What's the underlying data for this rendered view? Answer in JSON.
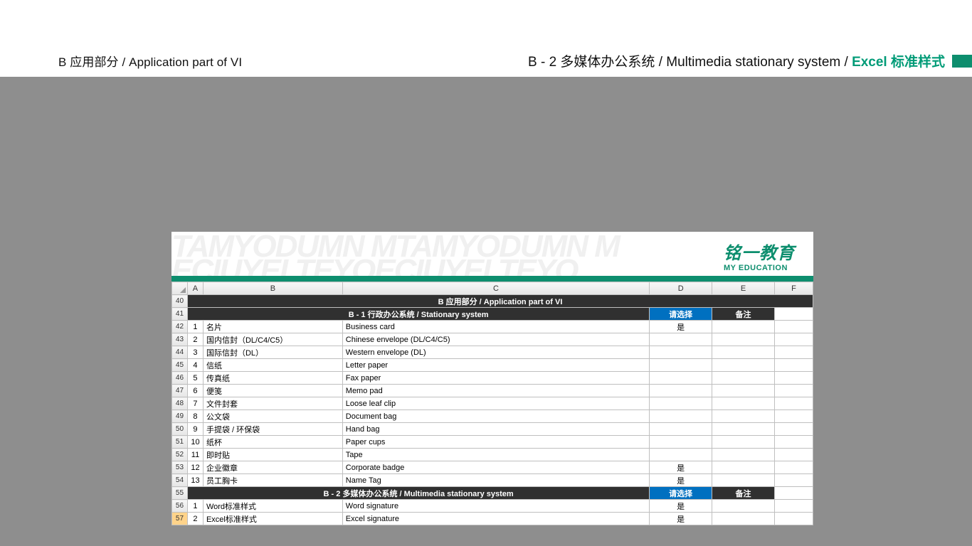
{
  "header": {
    "left": "B 应用部分 / Application part of VI",
    "right_prefix": "B - 2 多媒体办公系统 / Multimedia stationary system / ",
    "right_accent": "Excel 标准样式"
  },
  "brand": {
    "watermark_line1": "TAMYODUMN MTAMYODUMN M",
    "watermark_line2": "ECIUYELTEYOECIUYELTEYO",
    "logo_zh": "铭一教育",
    "logo_en": "MY EDUCATION"
  },
  "columns": [
    "",
    "A",
    "B",
    "C",
    "D",
    "E",
    "F"
  ],
  "row_start": 40,
  "selected_row": 57,
  "title_row": "B 应用部分 / Application part of VI",
  "section1": {
    "heading": "B - 1 行政办公系统 / Stationary system",
    "status_label": "请选择",
    "note_label": "备注",
    "rows": [
      {
        "n": "1",
        "zh": "名片",
        "en": "Business card",
        "d": "是"
      },
      {
        "n": "2",
        "zh": "国内信封（DL/C4/C5）",
        "en": "Chinese envelope (DL/C4/C5)",
        "d": ""
      },
      {
        "n": "3",
        "zh": "国际信封（DL）",
        "en": "Western envelope (DL)",
        "d": ""
      },
      {
        "n": "4",
        "zh": "信纸",
        "en": "Letter paper",
        "d": ""
      },
      {
        "n": "5",
        "zh": "传真纸",
        "en": "Fax paper",
        "d": ""
      },
      {
        "n": "6",
        "zh": "便笺",
        "en": "Memo pad",
        "d": ""
      },
      {
        "n": "7",
        "zh": "文件封套",
        "en": "Loose leaf clip",
        "d": ""
      },
      {
        "n": "8",
        "zh": "公文袋",
        "en": "Document bag",
        "d": ""
      },
      {
        "n": "9",
        "zh": "手提袋 / 环保袋",
        "en": "Hand bag",
        "d": ""
      },
      {
        "n": "10",
        "zh": "纸杯",
        "en": "Paper cups",
        "d": ""
      },
      {
        "n": "11",
        "zh": "即时贴",
        "en": "Tape",
        "d": ""
      },
      {
        "n": "12",
        "zh": "企业徽章",
        "en": "Corporate badge",
        "d": "是"
      },
      {
        "n": "13",
        "zh": "员工胸卡",
        "en": "Name Tag",
        "d": "是"
      }
    ]
  },
  "section2": {
    "heading": "B - 2 多媒体办公系统 / Multimedia stationary system",
    "status_label": "请选择",
    "note_label": "备注",
    "rows": [
      {
        "n": "1",
        "zh": "Word标准样式",
        "en": "Word signature",
        "d": "是"
      },
      {
        "n": "2",
        "zh": "Excel标准样式",
        "en": "Excel signature",
        "d": "是"
      }
    ]
  }
}
